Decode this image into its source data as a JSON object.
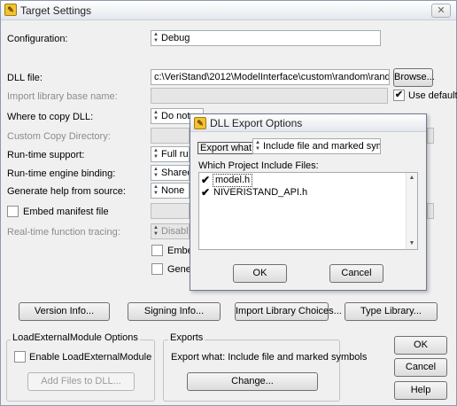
{
  "window": {
    "title": "Target Settings",
    "close": "✕"
  },
  "form": {
    "configuration": {
      "label": "Configuration:",
      "value": "Debug"
    },
    "dll_file": {
      "label": "DLL file:",
      "value": "c:\\VeriStand\\2012\\ModelInterface\\custom\\random\\rand.dll",
      "browse": "Browse..."
    },
    "import_lib": {
      "label": "Import library base name:",
      "use_default": "Use default"
    },
    "copy_dll": {
      "label": "Where to copy DLL:",
      "value": "Do not c"
    },
    "custom_copy_dir": {
      "label": "Custom Copy Directory:"
    },
    "runtime_support": {
      "label": "Run-time support:",
      "value": "Full run-"
    },
    "runtime_binding": {
      "label": "Run-time engine binding:",
      "value": "Shared"
    },
    "help_source": {
      "label": "Generate help from source:",
      "value": "None"
    },
    "embed_manifest": {
      "label": "Embed manifest file"
    },
    "realtime_tracing": {
      "label": "Real-time function tracing:",
      "value": "Disablec"
    },
    "embed_partial": "Embe",
    "gene_partial": "Gene"
  },
  "buttons": {
    "version_info": "Version Info...",
    "signing_info": "Signing Info...",
    "import_lib_choices": "Import Library Choices...",
    "type_library": "Type Library..."
  },
  "load_external": {
    "title": "LoadExternalModule Options",
    "enable": "Enable LoadExternalModule",
    "add_files": "Add Files to DLL..."
  },
  "exports": {
    "title": "Exports",
    "text": "Export what:  Include file and marked symbols",
    "change": "Change..."
  },
  "side_buttons": {
    "ok": "OK",
    "cancel": "Cancel",
    "help": "Help"
  },
  "dialog": {
    "title": "DLL Export Options",
    "export_what_label": "Export what:",
    "export_what_value": "Include file and marked symbols",
    "list_label": "Which Project Include Files:",
    "files": [
      {
        "name": "model.h",
        "checked": "✔"
      },
      {
        "name": "NIVERISTAND_API.h",
        "checked": "✔"
      }
    ],
    "ok": "OK",
    "cancel": "Cancel"
  }
}
